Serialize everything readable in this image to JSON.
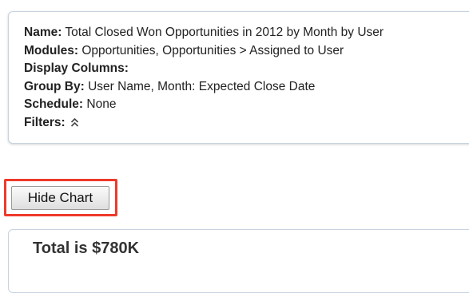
{
  "report_details": {
    "name_label": "Name:",
    "name_value": "Total Closed Won Opportunities in 2012 by Month by User",
    "modules_label": "Modules:",
    "modules_value": "Opportunities, Opportunities > Assigned to User",
    "display_columns_label": "Display Columns:",
    "display_columns_value": "",
    "group_by_label": "Group By:",
    "group_by_value": "User Name, Month: Expected Close Date",
    "schedule_label": "Schedule:",
    "schedule_value": "None",
    "filters_label": "Filters:",
    "filters_icon": "double-chevron-up-icon"
  },
  "actions": {
    "hide_chart_label": "Hide Chart",
    "highlight_color": "#ee3a2a"
  },
  "chart": {
    "total_text": "Total is $780K"
  }
}
